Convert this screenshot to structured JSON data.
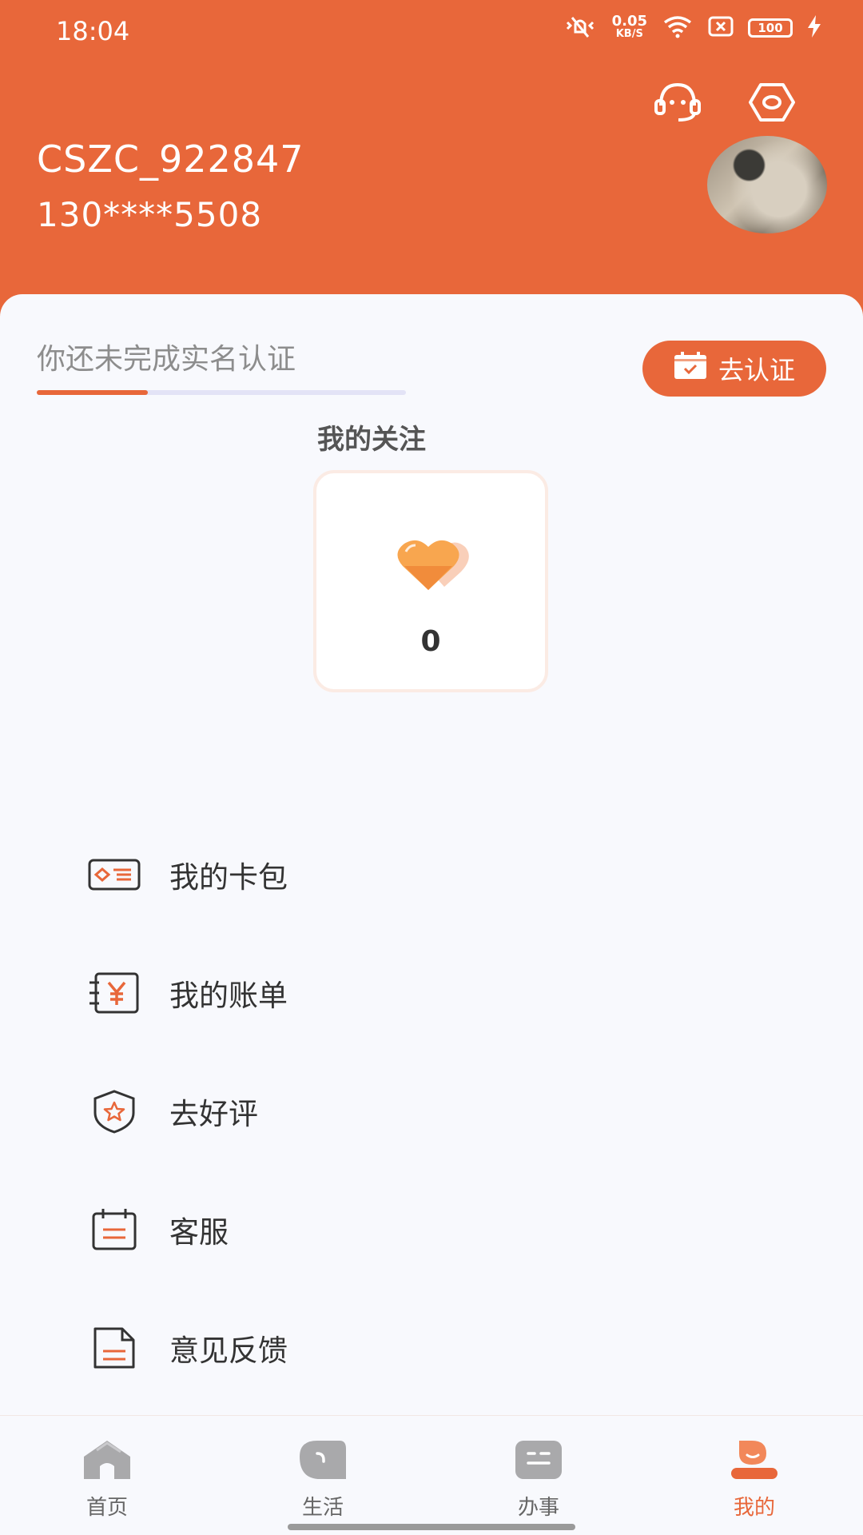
{
  "status_bar": {
    "time": "18:04",
    "speed_value": "0.05",
    "speed_unit": "KB/S",
    "battery": "100"
  },
  "profile": {
    "username": "CSZC_922847",
    "phone": "130****5508"
  },
  "verification": {
    "prompt": "你还未完成实名认证",
    "button_label": "去认证",
    "progress_fraction": 0.3
  },
  "follow": {
    "title": "我的关注",
    "count": "0"
  },
  "menu": {
    "items": [
      {
        "label": "我的卡包",
        "icon": "card-wallet-icon"
      },
      {
        "label": "我的账单",
        "icon": "bill-icon"
      },
      {
        "label": "去好评",
        "icon": "shield-star-icon"
      },
      {
        "label": "客服",
        "icon": "calendar-icon"
      },
      {
        "label": "意见反馈",
        "icon": "feedback-document-icon"
      }
    ]
  },
  "bottom_nav": {
    "items": [
      {
        "label": "首页",
        "icon": "home-icon"
      },
      {
        "label": "生活",
        "icon": "life-icon"
      },
      {
        "label": "办事",
        "icon": "affairs-icon"
      },
      {
        "label": "我的",
        "icon": "profile-icon"
      }
    ],
    "active_index": 3
  },
  "colors": {
    "brand": "#e8673a",
    "background": "#f8f9fd"
  }
}
